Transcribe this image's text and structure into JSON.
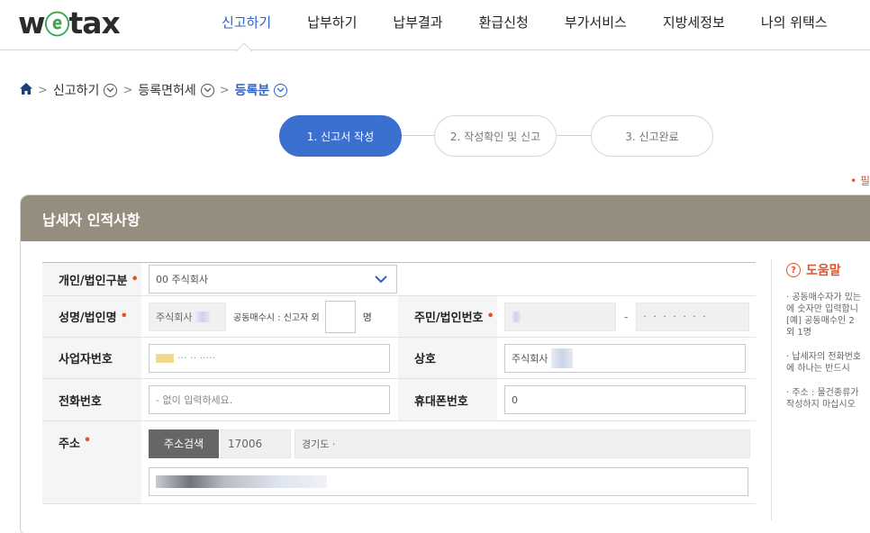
{
  "logo": {
    "pre": "w",
    "mid": "e",
    "post": "tax"
  },
  "nav": {
    "items": [
      "신고하기",
      "납부하기",
      "납부결과",
      "환급신청",
      "부가서비스",
      "지방세정보",
      "나의 위택스"
    ],
    "active_index": 0
  },
  "breadcrumb": {
    "home_icon": "home-icon",
    "items": [
      "신고하기",
      "등록면허세",
      "등록분"
    ]
  },
  "steps": [
    "1. 신고서 작성",
    "2. 작성확인 및 신고",
    "3. 신고완료"
  ],
  "required_note": "• 필",
  "panel": {
    "title": "납세자 인적사항",
    "colors": {
      "header_bg": "#958d7d",
      "accent": "#3b6fd0",
      "required": "#e0542a"
    }
  },
  "form": {
    "type_label": "개인/법인구분",
    "type_value": "00 주식회사",
    "name_label": "성명/법인명",
    "name_value": "주식회사",
    "joint_buyer_label": "공동매수시 : 신고자 외",
    "joint_buyer_unit": "명",
    "id_label": "주민/법인번호",
    "id_dash": "-",
    "id_masked": "· · · · · · ·",
    "bizno_label": "사업자번호",
    "bizno_value": "··· ·· ·····",
    "company_label": "상호",
    "company_value": "주식회사",
    "phone_label": "전화번호",
    "phone_placeholder": "- 없이 입력하세요.",
    "mobile_label": "휴대폰번호",
    "mobile_value": "0",
    "address_label": "주소",
    "address_button": "주소검색",
    "zipcode": "17006",
    "address1": "경기도 ·"
  },
  "help": {
    "title": "도움말",
    "items": [
      "· 공동매수자가 있는\n  에 숫자만 입력합니\n  [예] 공동매수인 2\n  외 1명",
      "· 납세자의 전화번호\n  에 하나는 반드시",
      "· 주소 : 물건종류가\n  작성하지 마십시오"
    ]
  }
}
